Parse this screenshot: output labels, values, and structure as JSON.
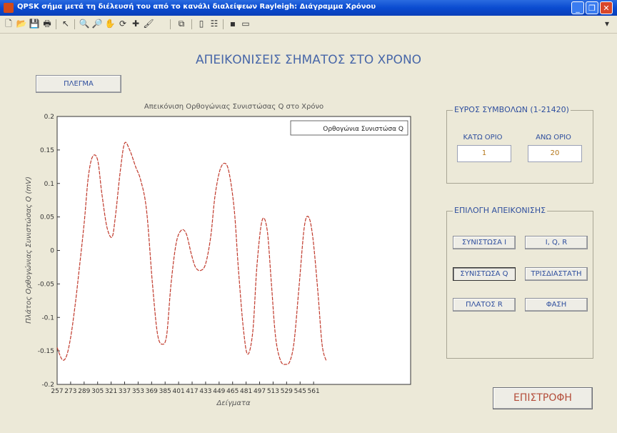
{
  "window": {
    "title": "QPSK σήμα μετά τη διέλευσή του από το κανάλι διαλείψεων Rayleigh: Διάγραμμα Χρόνου",
    "btn_min": "_",
    "btn_max": "❐",
    "btn_close": "✕"
  },
  "toolbar": {
    "icons": [
      "new-file-icon",
      "open-file-icon",
      "save-icon",
      "print-icon",
      "pointer-icon",
      "zoom-in-icon",
      "zoom-out-icon",
      "pan-icon",
      "rotate-icon",
      "data-cursor-icon",
      "brush-icon",
      "link-icon",
      "colorbar-icon",
      "legend-icon",
      "hide-plot-icon",
      "show-plot-icon"
    ],
    "overflow": "▾"
  },
  "heading": "ΑΠΕΙΚΟΝΙΣΕΙΣ ΣΗΜΑΤΟΣ ΣΤΟ ΧΡΟΝΟ",
  "grid_button": "ΠΛΕΓΜΑ",
  "symbols_panel": {
    "title": "ΕΥΡΟΣ ΣΥΜΒΟΛΩΝ (1-21420)",
    "lower_label": "ΚΑΤΩ ΟΡΙΟ",
    "upper_label": "ΑΝΩ ΟΡΙΟ",
    "lower_value": "1",
    "upper_value": "20"
  },
  "display_panel": {
    "title": "ΕΠΙΛΟΓΗ ΑΠΕΙΚΟΝΙΣΗΣ",
    "btn_i": "ΣΥΝΙΣΤΩΣΑ Ι",
    "btn_iqr": "I, Q, R",
    "btn_q": "ΣΥΝΙΣΤΩΣΑ Q",
    "btn_3d": "ΤΡΙΣΔΙΑΣΤΑΤΗ",
    "btn_r": "ΠΛΑΤΟΣ R",
    "btn_phase": "ΦΑΣΗ"
  },
  "back_button": "ΕΠΙΣΤΡΟΦΗ",
  "chart_data": {
    "type": "line",
    "title": "Απεικόνιση Ορθογώνιας Συνιστώσας Q στο Χρόνο",
    "xlabel": "Δείγματα",
    "ylabel": "Πλάτος Ορθογώνιας Συνιστώσας Q (mV)",
    "legend": "Ορθογώνια Συνιστώσα Q",
    "legend_position": "top-right",
    "grid": false,
    "xlim": [
      257,
      676
    ],
    "ylim": [
      -0.2,
      0.2
    ],
    "xticks": [
      257,
      273,
      289,
      305,
      321,
      337,
      353,
      369,
      385,
      401,
      417,
      433,
      449,
      465,
      481,
      497,
      513,
      529,
      545,
      561
    ],
    "yticks": [
      -0.2,
      -0.15,
      -0.1,
      -0.05,
      0,
      0.05,
      0.1,
      0.15,
      0.2
    ],
    "ytick_labels": [
      "-0.2",
      "-0.15",
      "-0.1",
      "-0.05",
      "0",
      "0.05",
      "0.1",
      "0.15",
      "0.2"
    ],
    "series": [
      {
        "name": "Ορθογώνια Συνιστώσα Q",
        "color": "#c0392b",
        "x": [
          257,
          263,
          268,
          273,
          278,
          283,
          289,
          294,
          299,
          305,
          310,
          316,
          322,
          326,
          332,
          337,
          343,
          350,
          356,
          363,
          370,
          376,
          382,
          387,
          392,
          398,
          404,
          410,
          416,
          421,
          427,
          433,
          439,
          444,
          450,
          456,
          461,
          467,
          472,
          478,
          483,
          489,
          494,
          500,
          506,
          511,
          516,
          522,
          528,
          533,
          538,
          544,
          550,
          555,
          560,
          566,
          571,
          576
        ],
        "y": [
          -0.145,
          -0.163,
          -0.158,
          -0.13,
          -0.085,
          -0.03,
          0.04,
          0.11,
          0.14,
          0.135,
          0.085,
          0.035,
          0.02,
          0.05,
          0.12,
          0.16,
          0.15,
          0.125,
          0.105,
          0.06,
          -0.05,
          -0.125,
          -0.14,
          -0.125,
          -0.05,
          0.01,
          0.03,
          0.025,
          -0.005,
          -0.025,
          -0.03,
          -0.02,
          0.02,
          0.08,
          0.12,
          0.13,
          0.115,
          0.06,
          -0.03,
          -0.12,
          -0.155,
          -0.12,
          -0.02,
          0.045,
          0.03,
          -0.05,
          -0.13,
          -0.165,
          -0.17,
          -0.165,
          -0.135,
          -0.05,
          0.035,
          0.05,
          0.02,
          -0.06,
          -0.14,
          -0.165
        ]
      }
    ]
  }
}
